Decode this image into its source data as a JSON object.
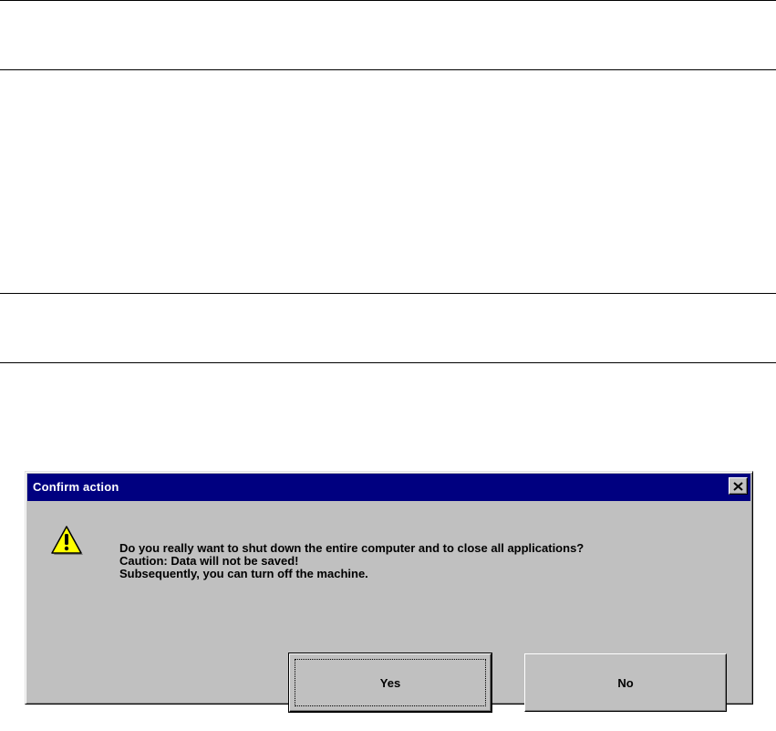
{
  "dialog": {
    "title": "Confirm action",
    "close_icon": "close-icon",
    "warning_icon": "warning-icon",
    "message_lines": [
      "Do you really want to shut down the entire computer and to close all applications?",
      "Caution: Data will not be saved!",
      "Subsequently, you can turn off the machine."
    ],
    "buttons": {
      "yes_label": "Yes",
      "no_label": "No"
    },
    "colors": {
      "titlebar": "#000080",
      "face": "#c0c0c0",
      "warning_fill": "#ffff00"
    }
  }
}
